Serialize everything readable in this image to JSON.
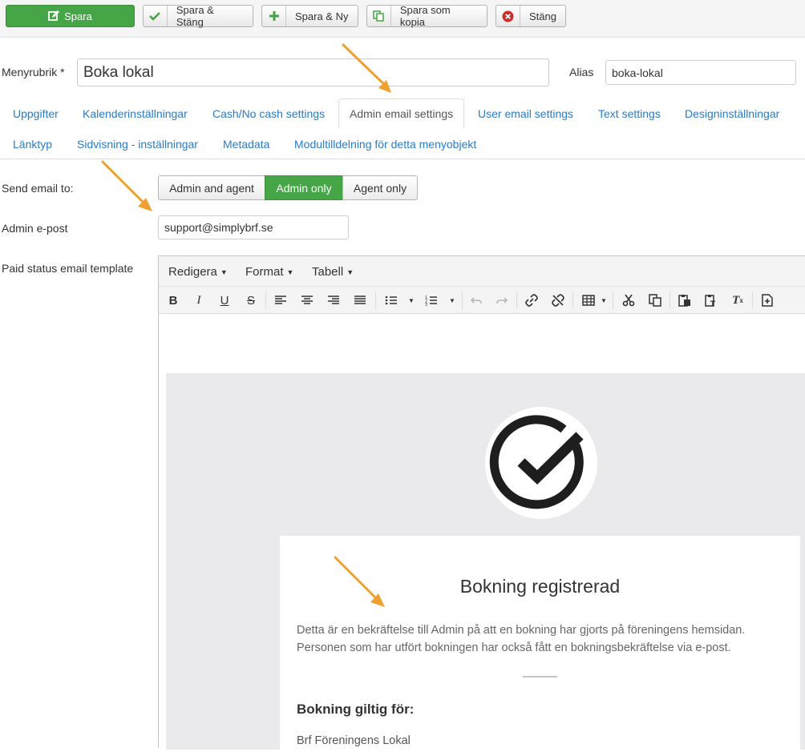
{
  "toolbar": {
    "save": "Spara",
    "save_close": "Spara & Stäng",
    "save_new": "Spara & Ny",
    "save_copy": "Spara som kopia",
    "close": "Stäng"
  },
  "form": {
    "title_label": "Menyrubrik *",
    "title_value": "Boka lokal",
    "alias_label": "Alias",
    "alias_value": "boka-lokal"
  },
  "tabs": [
    {
      "label": "Uppgifter",
      "active": false
    },
    {
      "label": "Kalenderinställningar",
      "active": false
    },
    {
      "label": "Cash/No cash settings",
      "active": false
    },
    {
      "label": "Admin email settings",
      "active": true
    },
    {
      "label": "User email settings",
      "active": false
    },
    {
      "label": "Text settings",
      "active": false
    },
    {
      "label": "Designinställningar",
      "active": false
    },
    {
      "label": "Länktyp",
      "active": false
    },
    {
      "label": "Sidvisning - inställningar",
      "active": false
    },
    {
      "label": "Metadata",
      "active": false
    },
    {
      "label": "Modultilldelning för detta menyobjekt",
      "active": false
    }
  ],
  "send_email": {
    "label": "Send email to:",
    "options": [
      "Admin and agent",
      "Admin only",
      "Agent only"
    ],
    "selected": "Admin only"
  },
  "admin_email": {
    "label": "Admin e-post",
    "value": "support@simplybrf.se"
  },
  "template": {
    "label": "Paid status email template",
    "menu": [
      "Redigera",
      "Format",
      "Tabell"
    ],
    "heading": "Bokning registrerad",
    "body_line1": "Detta är en bekräftelse till Admin på att en bokning har gjorts på föreningens hemsidan.",
    "body_line2": "Personen som har utfört bokningen har också fått en bokningsbekräftelse via e-post.",
    "subheading": "Bokning giltig för:",
    "venue": "Brf Föreningens Lokal"
  },
  "icons": {
    "save": "edit-icon",
    "save_close": "check-icon",
    "save_new": "plus-icon",
    "save_copy": "copy-icon",
    "close": "cancel-icon",
    "logo": "checkmark-circle-icon"
  },
  "colors": {
    "primary_green": "#46a546",
    "tab_link": "#2a7bc5",
    "annotation_arrow": "#f0a030",
    "close_red": "#c9302c"
  }
}
